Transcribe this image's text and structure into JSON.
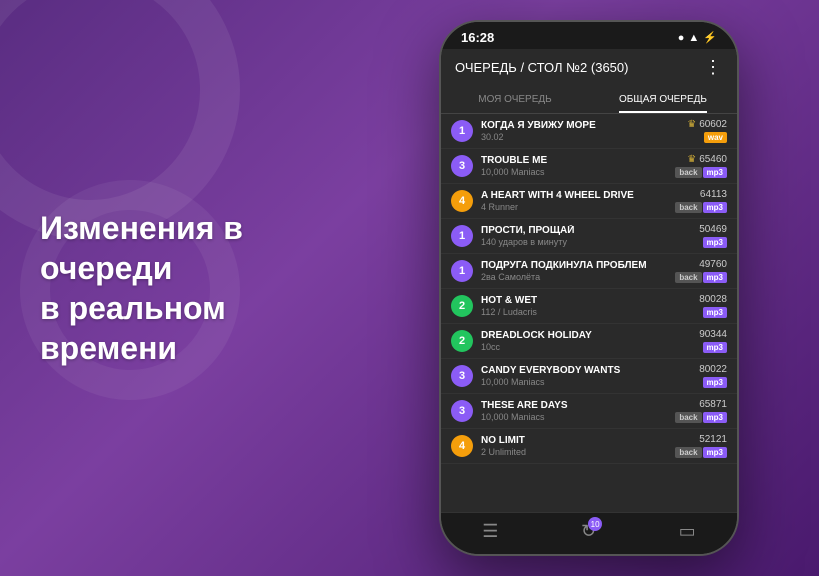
{
  "background": {
    "gradient_start": "#5a2d82",
    "gradient_end": "#4a1a6e"
  },
  "left_text": {
    "line1": "Изменения в очереди",
    "line2": "в реальном времени"
  },
  "phone": {
    "status_bar": {
      "time": "16:28",
      "icons": "●  ▲  ⚡"
    },
    "header": {
      "title": "ОЧЕРЕДЬ / СТОЛ №2 (3650)",
      "menu": "⋮"
    },
    "tabs": [
      {
        "label": "МОЯ ОЧЕРЕДЬ",
        "active": false
      },
      {
        "label": "ОБЩАЯ ОЧЕРЕДЬ",
        "active": true
      }
    ],
    "songs": [
      {
        "num": "1",
        "num_color": "purple",
        "title": "КОГДА Я УВИЖУ МОРЕ",
        "artist": "30.02",
        "id": "60602",
        "crown": true,
        "tags": [
          {
            "type": "wav",
            "label": "wav"
          }
        ]
      },
      {
        "num": "3",
        "num_color": "purple",
        "title": "TROUBLE ME",
        "artist": "10,000 Maniacs",
        "id": "65460",
        "crown": true,
        "tags": [
          {
            "type": "back",
            "label": "back"
          },
          {
            "type": "mp3",
            "label": "mp3"
          }
        ]
      },
      {
        "num": "4",
        "num_color": "orange",
        "title": "A HEART WITH 4 WHEEL DRIVE",
        "artist": "4 Runner",
        "id": "64113",
        "crown": false,
        "tags": [
          {
            "type": "back",
            "label": "back"
          },
          {
            "type": "mp3",
            "label": "mp3"
          }
        ]
      },
      {
        "num": "1",
        "num_color": "purple",
        "title": "ПРОСТИ, ПРОЩАЙ",
        "artist": "140 ударов в минуту",
        "id": "50469",
        "crown": false,
        "tags": [
          {
            "type": "mp3",
            "label": "mp3"
          }
        ]
      },
      {
        "num": "1",
        "num_color": "purple",
        "title": "ПОДРУГА ПОДКИНУЛА ПРОБЛЕМ",
        "artist": "2ва Самолёта",
        "id": "49760",
        "crown": false,
        "tags": [
          {
            "type": "back",
            "label": "back"
          },
          {
            "type": "mp3",
            "label": "mp3"
          }
        ]
      },
      {
        "num": "2",
        "num_color": "green",
        "title": "HOT & WET",
        "artist": "112 / Ludacris",
        "id": "80028",
        "crown": false,
        "tags": [
          {
            "type": "mp3",
            "label": "mp3"
          }
        ]
      },
      {
        "num": "2",
        "num_color": "green",
        "title": "DREADLOCK HOLIDAY",
        "artist": "10cc",
        "id": "90344",
        "crown": false,
        "tags": [
          {
            "type": "mp3",
            "label": "mp3"
          }
        ]
      },
      {
        "num": "3",
        "num_color": "purple",
        "title": "CANDY EVERYBODY WANTS",
        "artist": "10,000 Maniacs",
        "id": "80022",
        "crown": false,
        "tags": [
          {
            "type": "mp3",
            "label": "mp3"
          }
        ]
      },
      {
        "num": "3",
        "num_color": "purple",
        "title": "THESE ARE DAYS",
        "artist": "10,000 Maniacs",
        "id": "65871",
        "crown": false,
        "tags": [
          {
            "type": "back",
            "label": "back"
          },
          {
            "type": "mp3",
            "label": "mp3"
          }
        ]
      },
      {
        "num": "4",
        "num_color": "orange",
        "title": "NO LIMIT",
        "artist": "2 Unlimited",
        "id": "52121",
        "crown": false,
        "tags": [
          {
            "type": "back",
            "label": "back"
          },
          {
            "type": "mp3",
            "label": "mp3"
          }
        ]
      }
    ],
    "bottom_nav": [
      {
        "icon": "☰",
        "name": "queue-icon",
        "badge": null
      },
      {
        "icon": "↻",
        "name": "refresh-icon",
        "badge": "10"
      },
      {
        "icon": "▭",
        "name": "screen-icon",
        "badge": null
      }
    ]
  }
}
